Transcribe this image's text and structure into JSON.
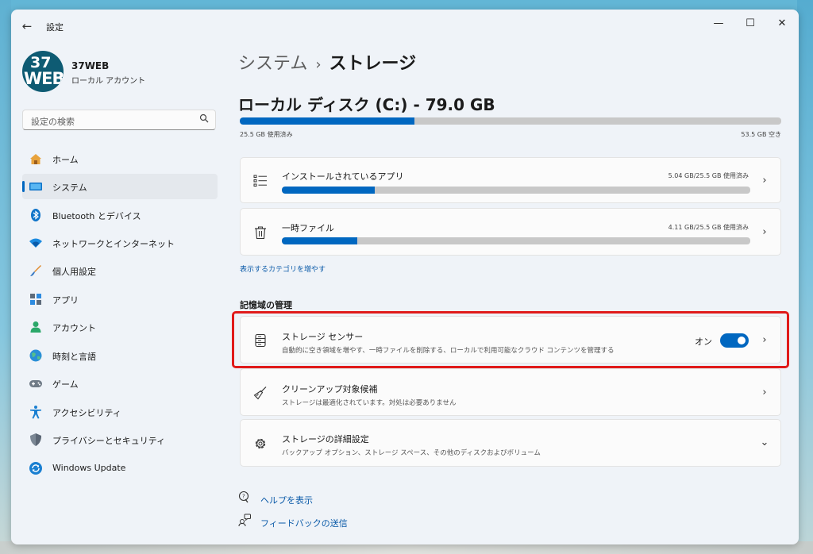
{
  "window": {
    "title": "設定",
    "controls": {
      "minimize": "—",
      "maximize": "☐",
      "close": "✕"
    },
    "back": "←"
  },
  "profile": {
    "avatar_line1": "37",
    "avatar_line2": "WEB",
    "name": "37WEB",
    "account_type": "ローカル アカウント"
  },
  "search": {
    "placeholder": "設定の検索",
    "icon": "search-icon"
  },
  "sidebar": {
    "items": [
      {
        "label": "ホーム",
        "icon": "home-icon"
      },
      {
        "label": "システム",
        "icon": "system-icon",
        "selected": true
      },
      {
        "label": "Bluetooth とデバイス",
        "icon": "bluetooth-icon"
      },
      {
        "label": "ネットワークとインターネット",
        "icon": "wifi-icon"
      },
      {
        "label": "個人用設定",
        "icon": "brush-icon"
      },
      {
        "label": "アプリ",
        "icon": "apps-icon"
      },
      {
        "label": "アカウント",
        "icon": "account-icon"
      },
      {
        "label": "時刻と言語",
        "icon": "globe-icon"
      },
      {
        "label": "ゲーム",
        "icon": "gamepad-icon"
      },
      {
        "label": "アクセシビリティ",
        "icon": "accessibility-icon"
      },
      {
        "label": "プライバシーとセキュリティ",
        "icon": "shield-icon"
      },
      {
        "label": "Windows Update",
        "icon": "update-icon"
      }
    ]
  },
  "breadcrumb": {
    "parent": "システム",
    "separator": "›",
    "current": "ストレージ"
  },
  "disk": {
    "title": "ローカル ディスク (C:) - 79.0 GB",
    "used_label": "25.5 GB 使用済み",
    "free_label": "53.5 GB 空き",
    "used_fraction": 0.323
  },
  "categories": [
    {
      "title": "インストールされているアプリ",
      "value": "5.04 GB/25.5 GB 使用済み",
      "fraction": 0.198,
      "icon": "list-icon"
    },
    {
      "title": "一時ファイル",
      "value": "4.11 GB/25.5 GB 使用済み",
      "fraction": 0.161,
      "icon": "trash-icon"
    }
  ],
  "show_more_link": "表示するカテゴリを増やす",
  "management": {
    "heading": "記憶域の管理",
    "items": [
      {
        "title": "ストレージ センサー",
        "subtitle": "自動的に空き領域を増やす、一時ファイルを削除する、ローカルで利用可能なクラウド コンテンツを管理する",
        "toggle_label": "オン",
        "toggle_on": true,
        "icon": "drive-icon"
      },
      {
        "title": "クリーンアップ対象候補",
        "subtitle": "ストレージは最適化されています。対処は必要ありません",
        "icon": "broom-icon"
      },
      {
        "title": "ストレージの詳細設定",
        "subtitle": "バックアップ オプション、ストレージ スペース、その他のディスクおよびボリューム",
        "icon": "gear-icon"
      }
    ]
  },
  "footer": {
    "help": "ヘルプを表示",
    "feedback": "フィードバックの送信"
  },
  "colors": {
    "accent": "#0067c0",
    "highlight": "#e01a1a",
    "track": "#c8c8c8"
  }
}
